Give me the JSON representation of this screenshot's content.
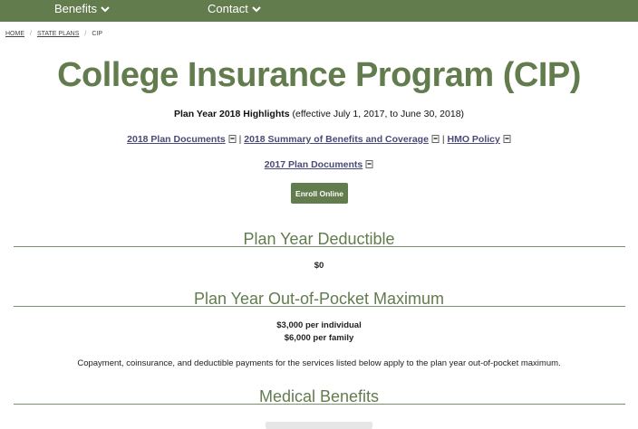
{
  "nav": {
    "items": [
      {
        "label": "Benefits"
      },
      {
        "label": "Contact"
      }
    ]
  },
  "breadcrumb": {
    "home": "HOME",
    "state_plans": "STATE PLANS",
    "current": "CIP"
  },
  "page": {
    "title": "College Insurance Program (CIP)",
    "highlights_bold": "Plan Year 2018 Highlights",
    "highlights_rest": " (effective July 1, 2017, to June 30, 2018)",
    "links_row1": {
      "plan_docs_2018": "2018 Plan Documents",
      "sep1": " | ",
      "summary_2018": "2018 Summary of Benefits and Coverage",
      "sep2": " | ",
      "hmo_policy": "HMO Policy"
    },
    "links_row2": {
      "plan_docs_2017": "2017 Plan Documents"
    },
    "enroll_label": "Enroll Online"
  },
  "sections": {
    "deductible": {
      "heading": "Plan Year Deductible",
      "value": "$0"
    },
    "oop": {
      "heading": "Plan Year Out-of-Pocket Maximum",
      "individual": "$3,000 per individual",
      "family": "$6,000 per family",
      "note": "Copayment, coinsurance, and deductible payments for the services listed below apply to the plan year out-of-pocket maximum."
    },
    "medical": {
      "heading": "Medical Benefits"
    }
  },
  "colors": {
    "brand_green": "#627c4e",
    "link": "#4a4a7a"
  }
}
